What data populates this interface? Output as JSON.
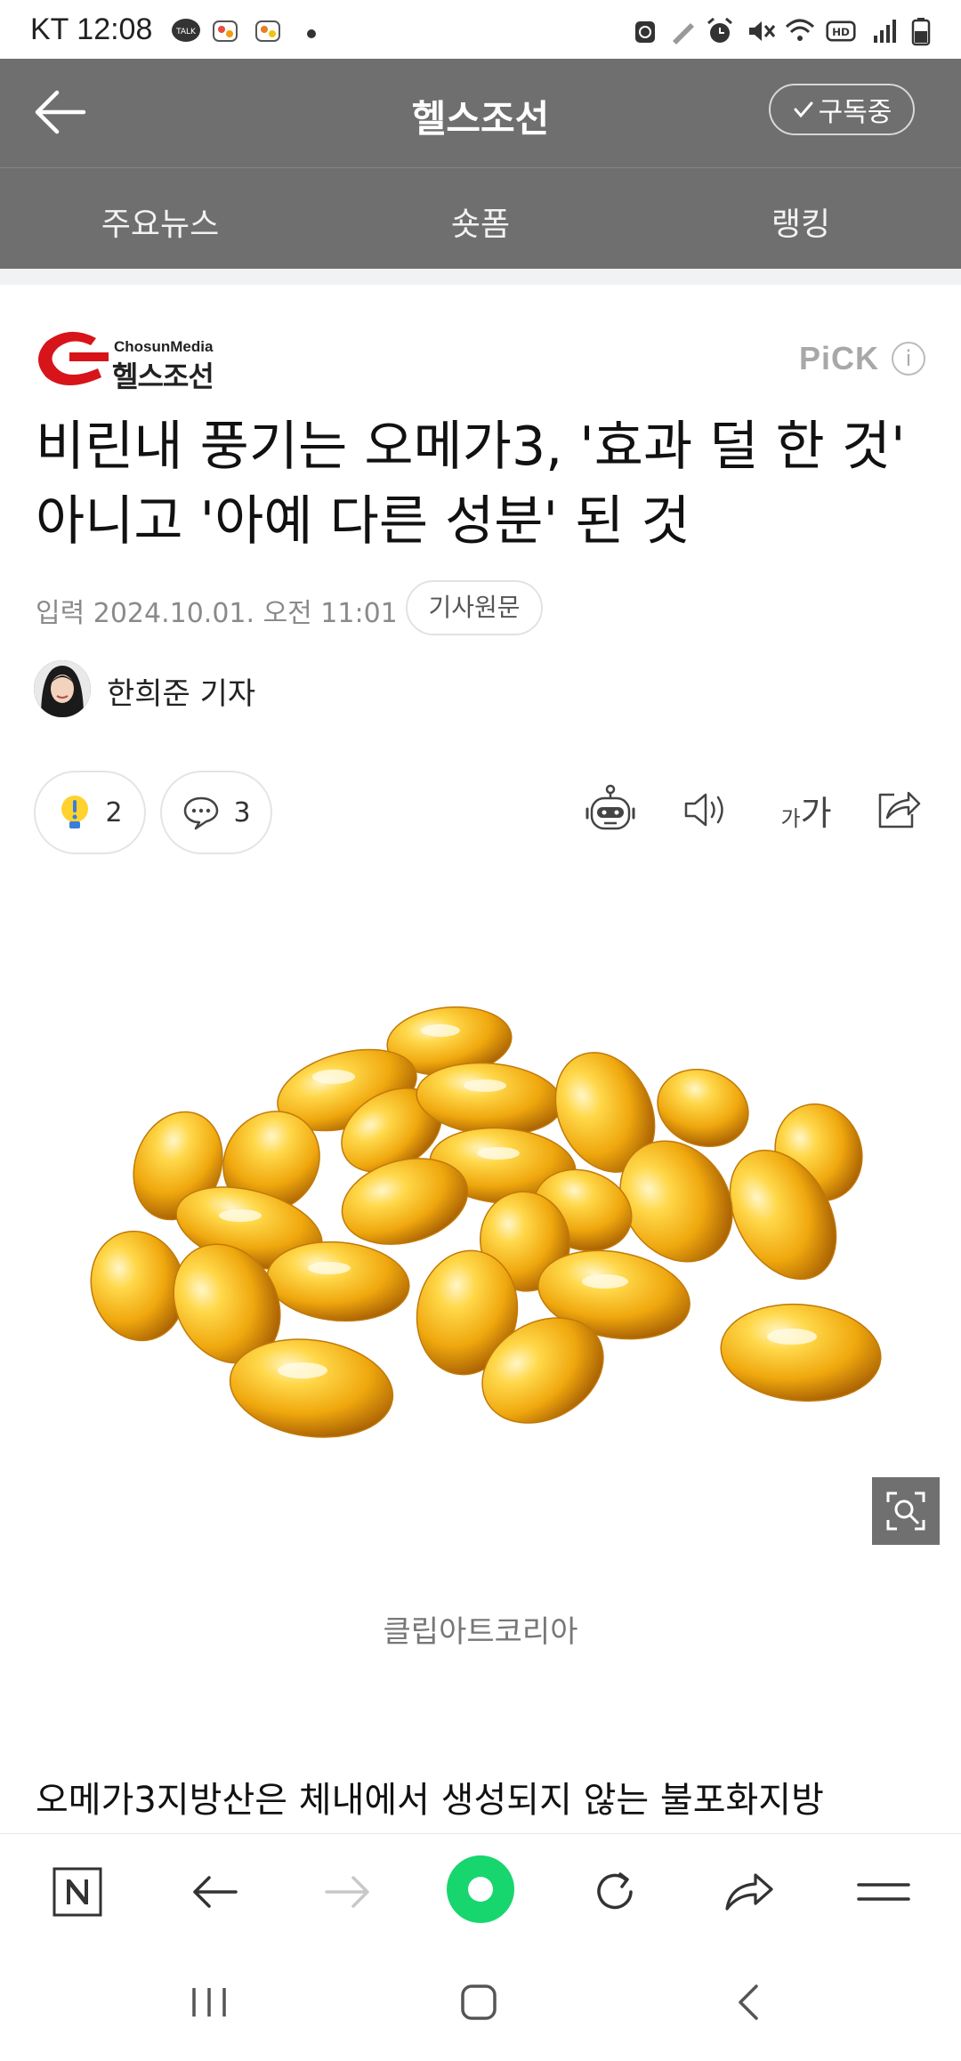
{
  "status_bar": {
    "carrier": "KT",
    "time": "12:08"
  },
  "header": {
    "title": "헬스조선",
    "subscribe_label": "구독중"
  },
  "tabs": [
    "주요뉴스",
    "숏폼",
    "랭킹"
  ],
  "article": {
    "brand_top": "ChosunMedia",
    "brand_name": "헬스조선",
    "pick_label": "PiCK",
    "pick_info": "i",
    "headline": "비린내 풍기는 오메가3, '효과 덜 한 것' 아니고 '아예 다른 성분' 된 것",
    "date": "입력 2024.10.01. 오전 11:01",
    "original_button": "기사원문",
    "reporter": "한희준 기자",
    "reaction_count": "2",
    "comment_count": "3",
    "font_size_label_small": "가",
    "font_size_label_large": "가",
    "image_caption": "클립아트코리아",
    "first_paragraph": "오메가3지방산은 체내에서 생성되지 않는 불포화지방"
  },
  "colors": {
    "header_bg": "#6f6f6f",
    "brand_red": "#d7141a",
    "capsule": "#f2b316",
    "green_home": "#17d66e"
  }
}
